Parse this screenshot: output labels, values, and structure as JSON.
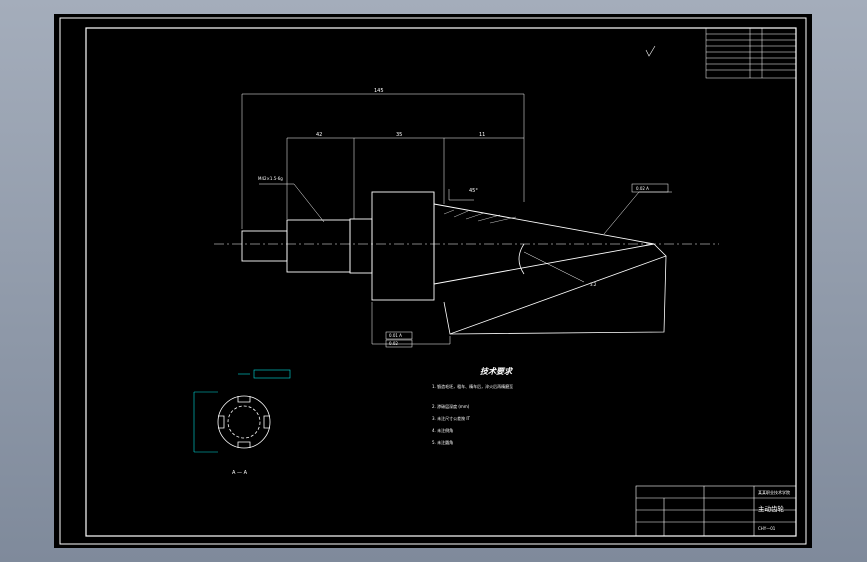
{
  "drawing": {
    "view_label": "A — A",
    "notes": {
      "heading": "技术要求",
      "items": [
        "1. 锻造毛坯，粗车、精车后，淬火后再精磨至",
        "2. 渗碳层深度 (mm)",
        "3. 未注尺寸公差按 IT",
        "4. 未注倒角",
        "5. 未注圆角"
      ]
    },
    "title_block": {
      "part_name": "主动齿轮",
      "drawing_code": "CHY—01",
      "institution": "某某职业技术学院"
    },
    "dimensions": {
      "overall": "145",
      "seg1": "42",
      "seg2": "35",
      "seg3": "11",
      "angle": "45°"
    },
    "callouts": {
      "thread": "M42×1.5-6g",
      "taper_tol": "0.02 A",
      "position_tol": "0.01 A",
      "flatness": "0.02",
      "roughness": "3.2"
    },
    "colors": {
      "linework": "#ffffff",
      "dimension_accent": "#00e0e0",
      "background": "#000000"
    }
  }
}
